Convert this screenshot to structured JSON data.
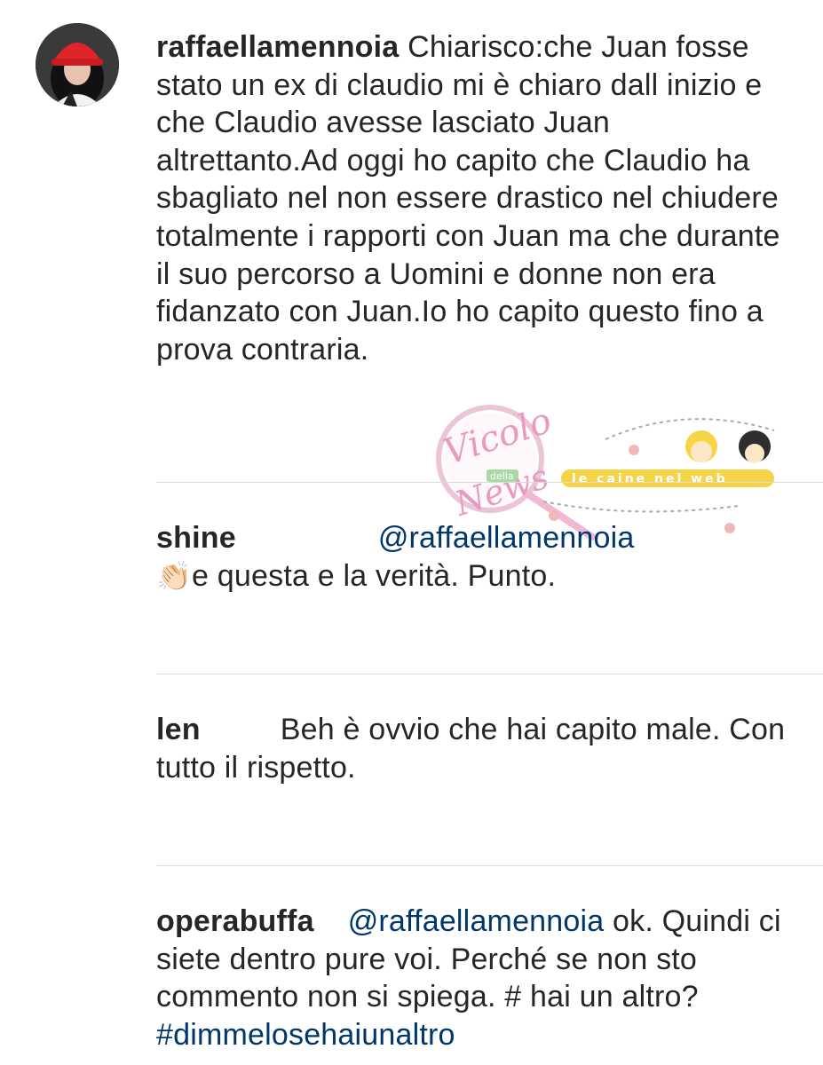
{
  "main_comment": {
    "username": "raffaellamennoia",
    "text": "Chiarisco:che Juan fosse stato un ex di claudio mi è chiaro dall inizio e che Claudio avesse lasciato Juan altrettanto.Ad oggi ho capito che Claudio ha sbagliato nel non essere drastico nel chiudere totalmente i rapporti con Juan ma che durante il suo percorso a Uomini e donne non era fidanzato con Juan.Io ho capito questo fino a prova contraria."
  },
  "replies": [
    {
      "username": "shine",
      "mention": "@raffaellamennoia",
      "emoji": "👏🏻",
      "text": "e questa e la verità. Punto."
    },
    {
      "username": "len",
      "text": "Beh è ovvio che hai capito male. Con tutto il rispetto."
    },
    {
      "username": "operabuffa",
      "mention": "@raffaellamennoia",
      "text_before": "ok. Quindi ci siete dentro pure voi. Perché se non sto commento non si spiega. # hai un altro?",
      "hashtag": "#dimmelosehaiunaltro"
    }
  ],
  "watermark": {
    "logo_line1": "Vicolo",
    "logo_line2": "della",
    "logo_line3": "News",
    "tagline": "le caine nel web"
  },
  "colors": {
    "text": "#262626",
    "link": "#00376b",
    "divider": "#dbdbdb",
    "watermark_pink": "#e89ac0",
    "watermark_yellow": "#f5d547"
  }
}
